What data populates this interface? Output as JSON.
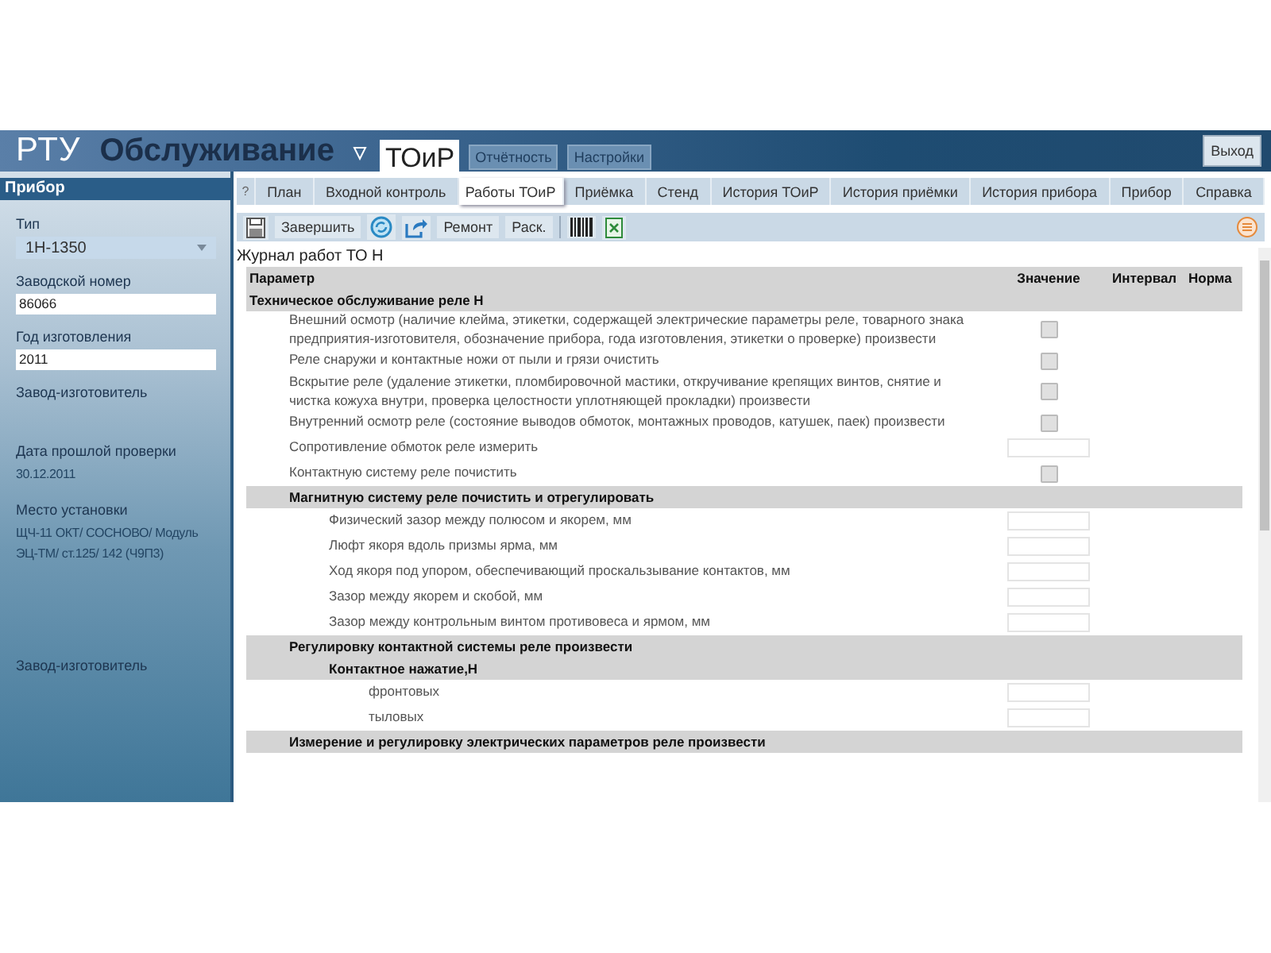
{
  "header": {
    "app": "РТУ",
    "title": "Обслуживание",
    "modules": [
      {
        "label": "ТОиР",
        "selected": true
      },
      {
        "label": "Отчётность",
        "selected": false
      },
      {
        "label": "Настройки",
        "selected": false
      }
    ],
    "exit": "Выход"
  },
  "sidebar": {
    "title": "Прибор",
    "fields": [
      {
        "kind": "select",
        "label": "Тип",
        "value": "1Н-1350"
      },
      {
        "kind": "input",
        "label": "Заводской номер",
        "value": "86066"
      },
      {
        "kind": "input",
        "label": "Год изготовления",
        "value": "2011"
      },
      {
        "kind": "text",
        "label": "Завод-изготовитель"
      },
      {
        "kind": "text",
        "label": "Дата прошлой проверки",
        "value": "30.12.2011"
      },
      {
        "kind": "text",
        "label": "Место установки",
        "value": "ЩЧ-11 ОКТ/ СОСНОВО/ Модуль ЭЦ-ТМ/ ст.125/ 142 (Ч9П3)"
      },
      {
        "kind": "text",
        "label": "Завод-изготовитель"
      }
    ]
  },
  "tabs": [
    {
      "label": "?",
      "selected": false
    },
    {
      "label": "План",
      "selected": false
    },
    {
      "label": "Входной контроль",
      "selected": false
    },
    {
      "label": "Работы ТОиР",
      "selected": true
    },
    {
      "label": "Приёмка",
      "selected": false
    },
    {
      "label": "Стенд",
      "selected": false
    },
    {
      "label": "История ТОиР",
      "selected": false
    },
    {
      "label": "История приёмки",
      "selected": false
    },
    {
      "label": "История прибора",
      "selected": false
    },
    {
      "label": "Прибор",
      "selected": false
    },
    {
      "label": "Справка",
      "selected": false
    }
  ],
  "toolbar": [
    {
      "kind": "save-icon"
    },
    {
      "kind": "button",
      "label": "Завершить"
    },
    {
      "kind": "refresh-icon"
    },
    {
      "kind": "export-icon"
    },
    {
      "kind": "button",
      "label": "Ремонт"
    },
    {
      "kind": "button",
      "label": "Раск."
    },
    {
      "kind": "barcode-icon"
    },
    {
      "kind": "excel-icon"
    }
  ],
  "journal": {
    "title": "Журнал работ ТО Н",
    "columns": [
      "Параметр",
      "Значение",
      "Интервал",
      "Норма"
    ],
    "rows": [
      {
        "kind": "section",
        "label": "Техническое обслуживание реле Н",
        "children": [
          {
            "kind": "check",
            "label": "Внешний осмотр (наличие клейма, этикетки, содержащей электрические параметры реле, товарного знака предприятия-изготовителя, обозначение прибора, года изготовления, этикетки о проверке) произвести",
            "checked": false
          },
          {
            "kind": "check",
            "label": "Реле снаружи и контактные ножи от пыли и грязи очистить",
            "checked": false
          },
          {
            "kind": "check",
            "label": "Вскрытие реле (удаление этикетки, пломбировочной мастики, откручивание крепящих винтов, снятие и чистка кожуха внутри, проверка целостности уплотняющей прокладки) произвести",
            "checked": false
          },
          {
            "kind": "check",
            "label": "Внутренний осмотр реле (состояние выводов обмоток, монтажных проводов, катушек, паек) произвести",
            "checked": false
          },
          {
            "kind": "input",
            "label": "Сопротивление обмоток реле измерить"
          },
          {
            "kind": "check",
            "label": "Контактную систему реле почистить",
            "checked": false
          },
          {
            "kind": "section",
            "label": "Магнитную систему реле почистить и отрегулировать",
            "children": [
              {
                "kind": "input",
                "label": "Физический зазор между полюсом и якорем, мм"
              },
              {
                "kind": "input",
                "label": "Люфт якоря вдоль призмы ярма, мм"
              },
              {
                "kind": "input",
                "label": "Ход якоря под упором, обеспечивающий проскальзывание контактов, мм"
              },
              {
                "kind": "input",
                "label": "Зазор между якорем и скобой, мм"
              },
              {
                "kind": "input",
                "label": "Зазор между контрольным винтом противовеса и ярмом, мм"
              }
            ]
          },
          {
            "kind": "section",
            "label": "Регулировку контактной системы реле произвести",
            "children": [
              {
                "kind": "section",
                "label": "Контактное нажатие,Н",
                "children": [
                  {
                    "kind": "input",
                    "label": "фронтовых"
                  },
                  {
                    "kind": "input",
                    "label": "тыловых"
                  }
                ]
              }
            ]
          },
          {
            "kind": "section",
            "label": "Измерение и регулировку электрических параметров реле произвести"
          }
        ]
      }
    ]
  }
}
